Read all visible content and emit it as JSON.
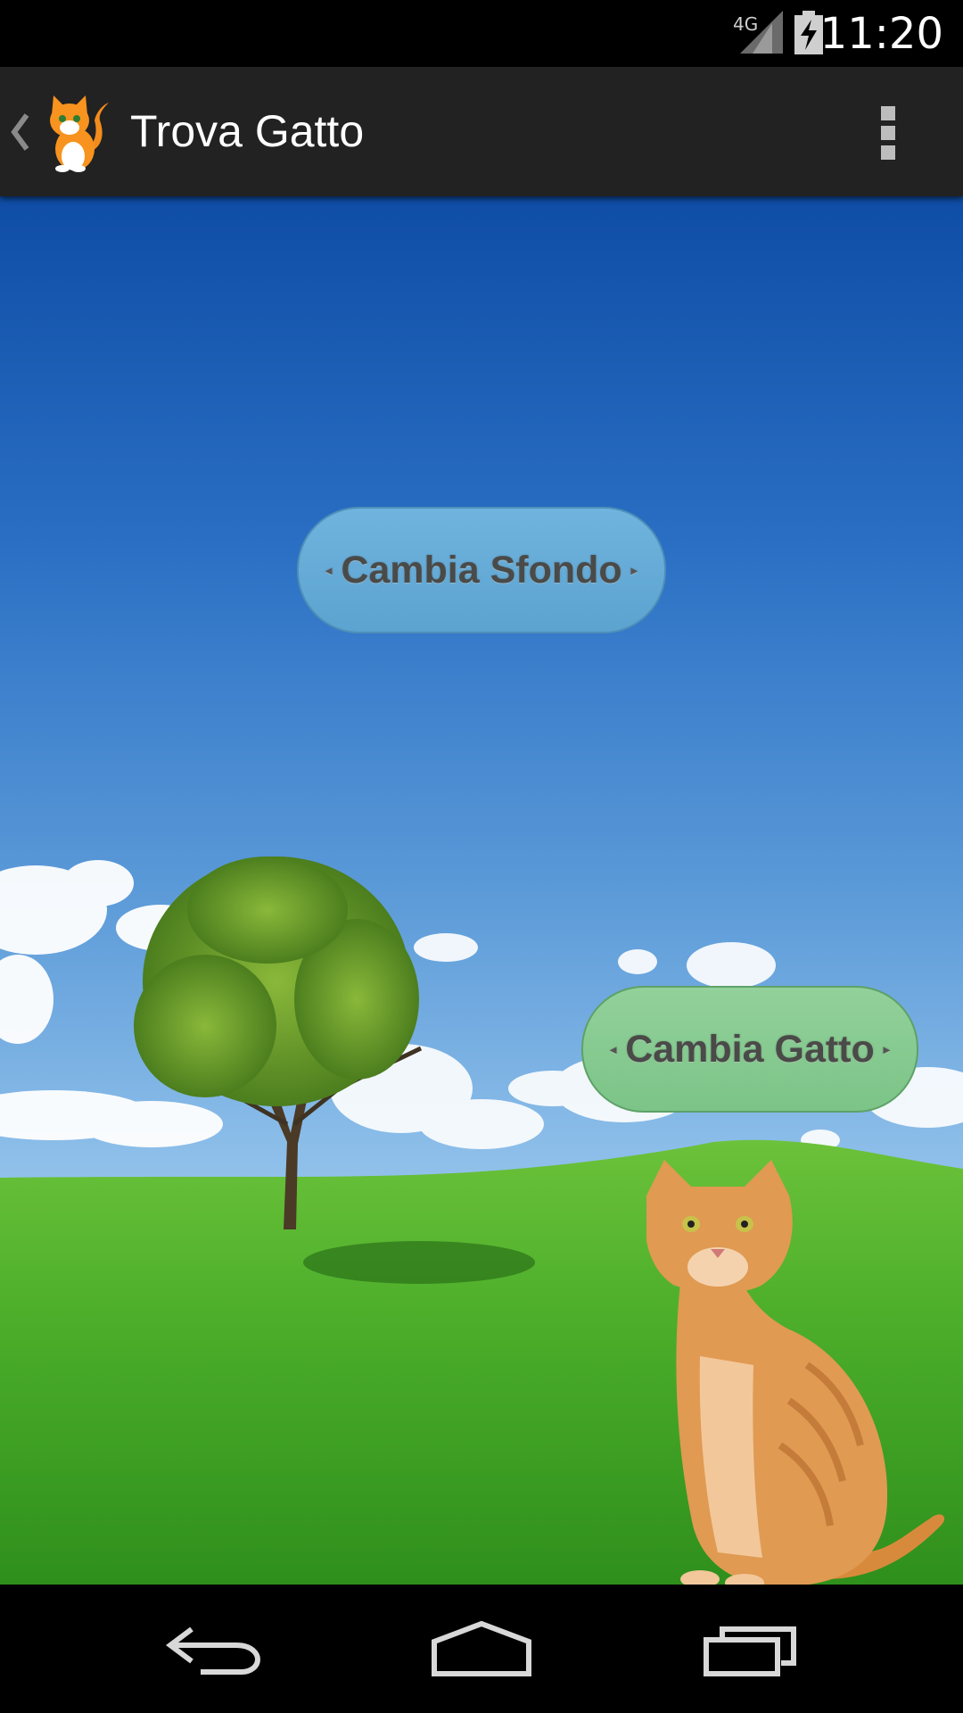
{
  "status_bar": {
    "time": "11:20",
    "network_label": "4G",
    "icons": [
      "signal-4g-icon",
      "battery-charging-icon"
    ]
  },
  "action_bar": {
    "title": "Trova Gatto",
    "icons": [
      "up-navigation-icon",
      "cat-app-icon",
      "overflow-menu-icon"
    ]
  },
  "main": {
    "change_background_button": "Cambia Sfondo",
    "change_cat_button": "Cambia Gatto"
  },
  "nav_bar": {
    "icons": [
      "back-icon",
      "home-icon",
      "recents-icon"
    ]
  },
  "colors": {
    "sky_top": "#0f4da6",
    "grass": "#4cae2a",
    "sfondo_button": "#5da3d0",
    "gatto_button": "#7cc488"
  }
}
